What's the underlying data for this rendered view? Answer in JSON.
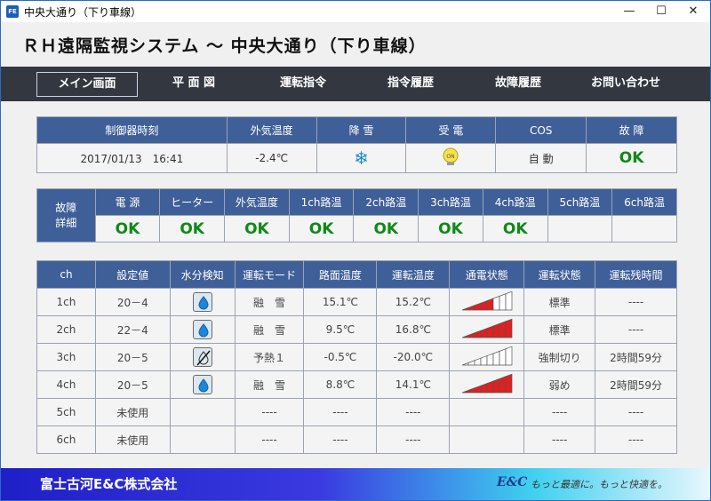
{
  "window": {
    "title": "中央大通り（下り車線）",
    "icon_text": "FE"
  },
  "app": {
    "title": "ＲＨ遠隔監視システム ～ 中央大通り（下り車線）"
  },
  "nav": [
    {
      "label": "メイン画面",
      "active": true
    },
    {
      "label": "平 面 図",
      "active": false
    },
    {
      "label": "運転指令",
      "active": false
    },
    {
      "label": "指令履歴",
      "active": false
    },
    {
      "label": "故障履歴",
      "active": false
    },
    {
      "label": "お問い合わせ",
      "active": false
    }
  ],
  "status": {
    "headers": [
      "制御器時刻",
      "外気温度",
      "降 雪",
      "受 電",
      "COS",
      "故 障"
    ],
    "controller_time": "2017/01/13　16:41",
    "outside_temp": "-2.4℃",
    "snowfall_icon": "snowflake-icon",
    "power_icon": "bulb-on-icon",
    "power_icon_text": "ON",
    "cos": "自 動",
    "fault": "OK"
  },
  "fault_detail": {
    "row_label": "故障詳細",
    "headers": [
      "電 源",
      "ヒーター",
      "外気温度",
      "1ch路温",
      "2ch路温",
      "3ch路温",
      "4ch路温",
      "5ch路温",
      "6ch路温"
    ],
    "values": [
      "OK",
      "OK",
      "OK",
      "OK",
      "OK",
      "OK",
      "OK",
      "",
      ""
    ]
  },
  "channels": {
    "headers": [
      "ch",
      "設定値",
      "水分検知",
      "運転モード",
      "路面温度",
      "運転温度",
      "通電状態",
      "運転状態",
      "運転残時間"
    ],
    "rows": [
      {
        "ch": "1ch",
        "setting": "20－4",
        "moisture": "drop",
        "mode": "融　雪",
        "road_temp": "15.1℃",
        "run_temp": "15.2℃",
        "power_level": 0.6,
        "state": "標準",
        "remaining": "----"
      },
      {
        "ch": "2ch",
        "setting": "22－4",
        "moisture": "drop",
        "mode": "融　雪",
        "road_temp": "9.5℃",
        "run_temp": "16.8℃",
        "power_level": 1.0,
        "state": "標準",
        "remaining": "----"
      },
      {
        "ch": "3ch",
        "setting": "20－5",
        "moisture": "drop-off",
        "mode": "予熱１",
        "road_temp": "-0.5℃",
        "run_temp": "-20.0℃",
        "power_level": 0,
        "state": "強制切り",
        "remaining": "2時間59分"
      },
      {
        "ch": "4ch",
        "setting": "20－5",
        "moisture": "drop",
        "mode": "融　雪",
        "road_temp": "8.8℃",
        "run_temp": "14.1℃",
        "power_level": 1.0,
        "state": "弱め",
        "remaining": "2時間59分"
      },
      {
        "ch": "5ch",
        "setting": "未使用",
        "moisture": "",
        "mode": "----",
        "road_temp": "----",
        "run_temp": "----",
        "power_level": null,
        "state": "----",
        "remaining": "----"
      },
      {
        "ch": "6ch",
        "setting": "未使用",
        "moisture": "",
        "mode": "----",
        "road_temp": "----",
        "run_temp": "----",
        "power_level": null,
        "state": "----",
        "remaining": "----"
      }
    ]
  },
  "footer": {
    "company": "富士古河E&C株式会社",
    "brand": "E&C",
    "slogan": "もっと最適に。もっと快適を。"
  },
  "colors": {
    "header_bg": "#3f5f99",
    "nav_bg": "#33373f",
    "ok": "#0d8a17",
    "power_bar": "#e02020"
  }
}
